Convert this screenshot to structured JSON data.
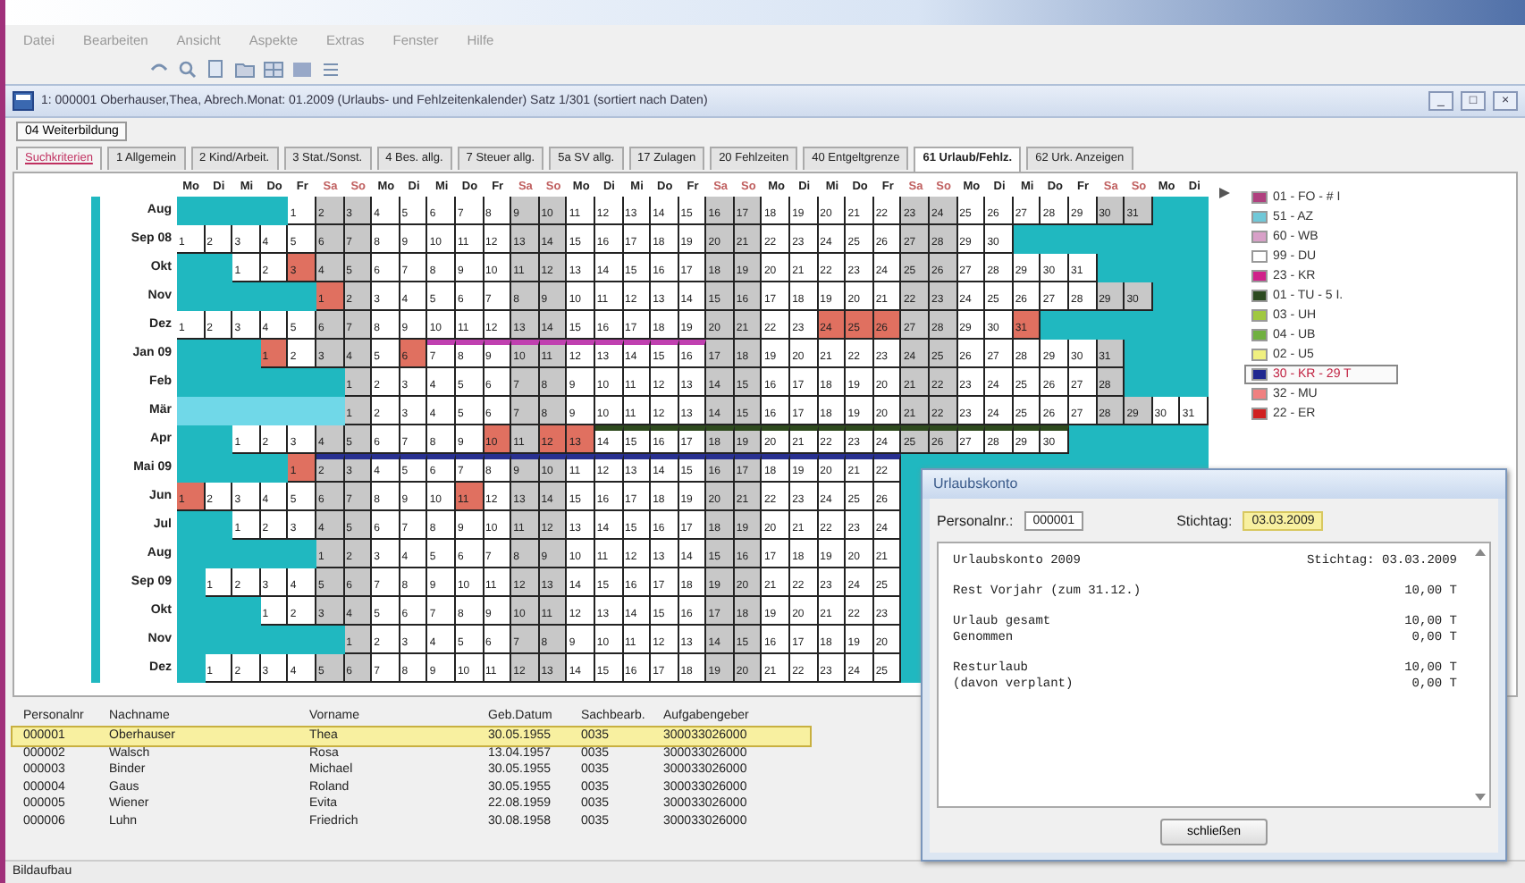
{
  "menu": [
    "Datei",
    "Bearbeiten",
    "Ansicht",
    "Aspekte",
    "Extras",
    "Fenster",
    "Hilfe"
  ],
  "form_title": "1: 000001 Oberhauser,Thea, Abrech.Monat: 01.2009  (Urlaubs- und Fehlzeitenkalender)   Satz 1/301 (sortiert nach Daten)",
  "window_buttons": [
    "_",
    "□",
    "×"
  ],
  "top_button": "04 Weiterbildung",
  "tabs": [
    {
      "label": "Suchkriterien",
      "selected": false,
      "kind": "link"
    },
    {
      "label": "1 Allgemein",
      "selected": false,
      "kind": "tab"
    },
    {
      "label": "2 Kind/Arbeit.",
      "selected": false,
      "kind": "tab"
    },
    {
      "label": "3 Stat./Sonst.",
      "selected": false,
      "kind": "tab"
    },
    {
      "label": "4 Bes. allg.",
      "selected": false,
      "kind": "tab"
    },
    {
      "label": "7 Steuer allg.",
      "selected": false,
      "kind": "tab"
    },
    {
      "label": "5a SV allg.",
      "selected": false,
      "kind": "tab"
    },
    {
      "label": "17 Zulagen",
      "selected": false,
      "kind": "tab"
    },
    {
      "label": "20 Fehlzeiten",
      "selected": false,
      "kind": "tab"
    },
    {
      "label": "40 Entgeltgrenze",
      "selected": false,
      "kind": "tab"
    },
    {
      "label": "61 Urlaub/Fehlz.",
      "selected": true,
      "kind": "tab"
    },
    {
      "label": "62 Urk. Anzeigen",
      "selected": false,
      "kind": "tab"
    }
  ],
  "weekdays": [
    {
      "text": "Mo",
      "kind": "work"
    },
    {
      "text": "Di",
      "kind": "work"
    },
    {
      "text": "Mi",
      "kind": "work"
    },
    {
      "text": "Do",
      "kind": "work"
    },
    {
      "text": "Fr",
      "kind": "work"
    },
    {
      "text": "Sa",
      "kind": "weekend"
    },
    {
      "text": "So",
      "kind": "weekend"
    },
    {
      "text": "Mo",
      "kind": "work"
    },
    {
      "text": "Di",
      "kind": "work"
    },
    {
      "text": "Mi",
      "kind": "work"
    },
    {
      "text": "Do",
      "kind": "work"
    },
    {
      "text": "Fr",
      "kind": "work"
    },
    {
      "text": "Sa",
      "kind": "weekend"
    },
    {
      "text": "So",
      "kind": "weekend"
    },
    {
      "text": "Mo",
      "kind": "work"
    },
    {
      "text": "Di",
      "kind": "work"
    },
    {
      "text": "Mi",
      "kind": "work"
    },
    {
      "text": "Do",
      "kind": "work"
    },
    {
      "text": "Fr",
      "kind": "work"
    },
    {
      "text": "Sa",
      "kind": "weekend"
    },
    {
      "text": "So",
      "kind": "weekend"
    },
    {
      "text": "Mo",
      "kind": "work"
    },
    {
      "text": "Di",
      "kind": "work"
    },
    {
      "text": "Mi",
      "kind": "work"
    },
    {
      "text": "Do",
      "kind": "work"
    },
    {
      "text": "Fr",
      "kind": "work"
    },
    {
      "text": "Sa",
      "kind": "weekend"
    },
    {
      "text": "So",
      "kind": "weekend"
    },
    {
      "text": "Mo",
      "kind": "work"
    },
    {
      "text": "Di",
      "kind": "work"
    },
    {
      "text": "Mi",
      "kind": "work"
    },
    {
      "text": "Do",
      "kind": "work"
    },
    {
      "text": "Fr",
      "kind": "work"
    },
    {
      "text": "Sa",
      "kind": "weekend"
    },
    {
      "text": "So",
      "kind": "weekend"
    },
    {
      "text": "Mo",
      "kind": "work"
    },
    {
      "text": "Di",
      "kind": "work"
    }
  ],
  "months": [
    {
      "label": "Aug",
      "selected": false,
      "days": [
        {
          "kind": "blocked"
        },
        {
          "kind": "blocked"
        },
        {
          "kind": "blocked"
        },
        {
          "kind": "blocked"
        },
        "1",
        "2",
        "3",
        "4",
        "5",
        "6",
        "7",
        "8",
        "9",
        "10",
        "11",
        "12",
        "13",
        "14",
        "15",
        "16",
        "17",
        "18",
        "19",
        "20",
        "21",
        "22",
        "23",
        "24",
        "25",
        "26",
        "27",
        "28",
        "29",
        "30",
        "31"
      ]
    },
    {
      "label": "Sep 08",
      "selected": false,
      "days": [
        "1",
        "2",
        "3",
        "4",
        "5",
        "6",
        "7",
        "8",
        "9",
        "10",
        "11",
        "12",
        "13",
        "14",
        "15",
        "16",
        "17",
        "18",
        "19",
        "20",
        "21",
        "22",
        "23",
        "24",
        "25",
        "26",
        "27",
        "28",
        "29",
        "30"
      ]
    },
    {
      "label": "Okt",
      "selected": false,
      "days": [
        {
          "kind": "blocked"
        },
        {
          "kind": "blocked"
        },
        "1",
        "2",
        {
          "text": "3",
          "kind": "absence"
        },
        "4",
        "5",
        "6",
        "7",
        "8",
        "9",
        "10",
        "11",
        "12",
        "13",
        "14",
        "15",
        "16",
        "17",
        "18",
        "19",
        "20",
        "21",
        "22",
        "23",
        "24",
        "25",
        "26",
        "27",
        "28",
        "29",
        "30",
        "31"
      ]
    },
    {
      "label": "Nov",
      "selected": false,
      "days": [
        {
          "kind": "blocked"
        },
        {
          "kind": "blocked"
        },
        {
          "kind": "blocked"
        },
        {
          "kind": "blocked"
        },
        {
          "kind": "blocked"
        },
        {
          "text": "1",
          "kind": "absence"
        },
        "2",
        "3",
        "4",
        "5",
        "6",
        "7",
        "8",
        "9",
        "10",
        "11",
        "12",
        "13",
        "14",
        "15",
        "16",
        "17",
        "18",
        "19",
        "20",
        "21",
        "22",
        "23",
        "24",
        "25",
        "26",
        "27",
        "28",
        "29",
        "30"
      ]
    },
    {
      "label": "Dez",
      "selected": false,
      "days": [
        "1",
        "2",
        "3",
        "4",
        "5",
        "6",
        "7",
        "8",
        "9",
        "10",
        "11",
        "12",
        "13",
        "14",
        "15",
        "16",
        "17",
        "18",
        "19",
        "20",
        "21",
        "22",
        "23",
        {
          "text": "24",
          "kind": "absence"
        },
        {
          "text": "25",
          "kind": "absence"
        },
        {
          "text": "26",
          "kind": "absence"
        },
        "27",
        "28",
        "29",
        "30",
        {
          "text": "31",
          "kind": "absence"
        }
      ]
    },
    {
      "label": "Jan 09",
      "selected": false,
      "days": [
        {
          "kind": "blocked"
        },
        {
          "kind": "blocked"
        },
        {
          "kind": "blocked"
        },
        {
          "text": "1",
          "kind": "absence"
        },
        "2",
        "3",
        "4",
        "5",
        {
          "text": "6",
          "kind": "absence"
        },
        {
          "text": "7",
          "kind": "band",
          "color": "#c040b0"
        },
        {
          "text": "8",
          "kind": "band",
          "color": "#c040b0"
        },
        {
          "text": "9",
          "kind": "band",
          "color": "#c040b0"
        },
        {
          "text": "10",
          "kind": "band",
          "color": "#c040b0"
        },
        {
          "text": "11",
          "kind": "band",
          "color": "#c040b0"
        },
        {
          "text": "12",
          "kind": "band",
          "color": "#c040b0"
        },
        {
          "text": "13",
          "kind": "band",
          "color": "#c040b0"
        },
        {
          "text": "14",
          "kind": "band",
          "color": "#c040b0"
        },
        {
          "text": "15",
          "kind": "band",
          "color": "#c040b0"
        },
        {
          "text": "16",
          "kind": "band",
          "color": "#c040b0"
        },
        "17",
        "18",
        "19",
        "20",
        "21",
        "22",
        "23",
        "24",
        "25",
        "26",
        "27",
        "28",
        "29",
        "30",
        "31"
      ]
    },
    {
      "label": "Feb",
      "selected": false,
      "days": [
        {
          "kind": "blocked"
        },
        {
          "kind": "blocked"
        },
        {
          "kind": "blocked"
        },
        {
          "kind": "blocked"
        },
        {
          "kind": "blocked"
        },
        {
          "kind": "blocked"
        },
        "1",
        "2",
        "3",
        "4",
        "5",
        "6",
        "7",
        "8",
        "9",
        "10",
        "11",
        "12",
        "13",
        "14",
        "15",
        "16",
        "17",
        "18",
        "19",
        "20",
        "21",
        "22",
        "23",
        "24",
        "25",
        "26",
        "27",
        "28"
      ]
    },
    {
      "label": "Mär",
      "selected": true,
      "days": [
        {
          "kind": "blocked"
        },
        {
          "kind": "blocked"
        },
        {
          "kind": "blocked"
        },
        {
          "kind": "blocked"
        },
        {
          "kind": "blocked"
        },
        {
          "kind": "blocked"
        },
        "1",
        "2",
        "3",
        "4",
        "5",
        "6",
        "7",
        "8",
        "9",
        "10",
        "11",
        "12",
        "13",
        "14",
        "15",
        "16",
        "17",
        "18",
        "19",
        "20",
        "21",
        "22",
        "23",
        "24",
        "25",
        "26",
        "27",
        "28",
        "29",
        "30",
        "31"
      ]
    },
    {
      "label": "Apr",
      "selected": false,
      "days": [
        {
          "kind": "blocked"
        },
        {
          "kind": "blocked"
        },
        "1",
        "2",
        "3",
        "4",
        "5",
        "6",
        "7",
        "8",
        "9",
        {
          "text": "10",
          "kind": "absence"
        },
        "11",
        {
          "text": "12",
          "kind": "absence"
        },
        {
          "text": "13",
          "kind": "absence"
        },
        {
          "text": "14",
          "kind": "band",
          "color": "#2e4a1e"
        },
        {
          "text": "15",
          "kind": "band",
          "color": "#2e4a1e"
        },
        {
          "text": "16",
          "kind": "band",
          "color": "#2e4a1e"
        },
        {
          "text": "17",
          "kind": "band",
          "color": "#2e4a1e"
        },
        {
          "text": "18",
          "kind": "band",
          "color": "#2e4a1e"
        },
        {
          "text": "19",
          "kind": "band",
          "color": "#2e4a1e"
        },
        {
          "text": "20",
          "kind": "band",
          "color": "#2e4a1e"
        },
        {
          "text": "21",
          "kind": "band",
          "color": "#2e4a1e"
        },
        {
          "text": "22",
          "kind": "band",
          "color": "#2e4a1e"
        },
        {
          "text": "23",
          "kind": "band",
          "color": "#2e4a1e"
        },
        {
          "text": "24",
          "kind": "band",
          "color": "#2e4a1e"
        },
        {
          "text": "25",
          "kind": "band",
          "color": "#2e4a1e"
        },
        {
          "text": "26",
          "kind": "band",
          "color": "#2e4a1e"
        },
        {
          "text": "27",
          "kind": "band",
          "color": "#2e4a1e"
        },
        {
          "text": "28",
          "kind": "band",
          "color": "#2e4a1e"
        },
        {
          "text": "29",
          "kind": "band",
          "color": "#2e4a1e"
        },
        {
          "text": "30",
          "kind": "band",
          "color": "#2e4a1e"
        }
      ]
    },
    {
      "label": "Mai 09",
      "selected": false,
      "days": [
        {
          "kind": "blocked"
        },
        {
          "kind": "blocked"
        },
        {
          "kind": "blocked"
        },
        {
          "kind": "blocked"
        },
        {
          "text": "1",
          "kind": "absence"
        },
        {
          "text": "2",
          "kind": "band",
          "color": "#283090"
        },
        {
          "text": "3",
          "kind": "band",
          "color": "#283090"
        },
        {
          "text": "4",
          "kind": "band",
          "color": "#283090"
        },
        {
          "text": "5",
          "kind": "band",
          "color": "#283090"
        },
        {
          "text": "6",
          "kind": "band",
          "color": "#283090"
        },
        {
          "text": "7",
          "kind": "band",
          "color": "#283090"
        },
        {
          "text": "8",
          "kind": "band",
          "color": "#283090"
        },
        {
          "text": "9",
          "kind": "band",
          "color": "#283090"
        },
        {
          "text": "10",
          "kind": "band",
          "color": "#283090"
        },
        {
          "text": "11",
          "kind": "band",
          "color": "#283090"
        },
        {
          "text": "12",
          "kind": "band",
          "color": "#283090"
        },
        {
          "text": "13",
          "kind": "band",
          "color": "#283090"
        },
        {
          "text": "14",
          "kind": "band",
          "color": "#283090"
        },
        {
          "text": "15",
          "kind": "band",
          "color": "#283090"
        },
        {
          "text": "16",
          "kind": "band",
          "color": "#283090"
        },
        {
          "text": "17",
          "kind": "band",
          "color": "#283090"
        },
        {
          "text": "18",
          "kind": "band",
          "color": "#283090"
        },
        {
          "text": "19",
          "kind": "band",
          "color": "#283090"
        },
        {
          "text": "20",
          "kind": "band",
          "color": "#283090"
        },
        {
          "text": "21",
          "kind": "band",
          "color": "#283090"
        },
        {
          "text": "22",
          "kind": "band",
          "color": "#283090"
        }
      ]
    },
    {
      "label": "Jun",
      "selected": false,
      "days": [
        {
          "text": "1",
          "kind": "absence"
        },
        "2",
        "3",
        "4",
        "5",
        "6",
        "7",
        "8",
        "9",
        "10",
        {
          "text": "11",
          "kind": "absence"
        },
        "12",
        "13",
        "14",
        "15",
        "16",
        "17",
        "18",
        "19",
        "20",
        "21",
        "22",
        "23",
        "24",
        "25",
        "26"
      ]
    },
    {
      "label": "Jul",
      "selected": false,
      "days": [
        {
          "kind": "blocked"
        },
        {
          "kind": "blocked"
        },
        "1",
        "2",
        "3",
        "4",
        "5",
        "6",
        "7",
        "8",
        "9",
        "10",
        "11",
        "12",
        "13",
        "14",
        "15",
        "16",
        "17",
        "18",
        "19",
        "20",
        "21",
        "22",
        "23",
        "24"
      ]
    },
    {
      "label": "Aug",
      "selected": false,
      "days": [
        {
          "kind": "blocked"
        },
        {
          "kind": "blocked"
        },
        {
          "kind": "blocked"
        },
        {
          "kind": "blocked"
        },
        {
          "kind": "blocked"
        },
        "1",
        "2",
        "3",
        "4",
        "5",
        "6",
        "7",
        "8",
        "9",
        "10",
        "11",
        "12",
        "13",
        "14",
        "15",
        "16",
        "17",
        "18",
        "19",
        "20",
        "21"
      ]
    },
    {
      "label": "Sep 09",
      "selected": false,
      "days": [
        {
          "kind": "blocked"
        },
        "1",
        "2",
        "3",
        "4",
        "5",
        "6",
        "7",
        "8",
        "9",
        "10",
        "11",
        "12",
        "13",
        "14",
        "15",
        "16",
        "17",
        "18",
        "19",
        "20",
        "21",
        "22",
        "23",
        "24",
        "25"
      ]
    },
    {
      "label": "Okt",
      "selected": false,
      "days": [
        {
          "kind": "blocked"
        },
        {
          "kind": "blocked"
        },
        {
          "kind": "blocked"
        },
        "1",
        "2",
        "3",
        "4",
        "5",
        "6",
        "7",
        "8",
        "9",
        "10",
        "11",
        "12",
        "13",
        "14",
        "15",
        "16",
        "17",
        "18",
        "19",
        "20",
        "21",
        "22",
        "23"
      ]
    },
    {
      "label": "Nov",
      "selected": false,
      "days": [
        {
          "kind": "blocked"
        },
        {
          "kind": "blocked"
        },
        {
          "kind": "blocked"
        },
        {
          "kind": "blocked"
        },
        {
          "kind": "blocked"
        },
        {
          "kind": "blocked"
        },
        "1",
        "2",
        "3",
        "4",
        "5",
        "6",
        "7",
        "8",
        "9",
        "10",
        "11",
        "12",
        "13",
        "14",
        "15",
        "16",
        "17",
        "18",
        "19",
        "20"
      ]
    },
    {
      "label": "Dez",
      "selected": false,
      "days": [
        {
          "kind": "blocked"
        },
        "1",
        "2",
        "3",
        "4",
        "5",
        "6",
        "7",
        "8",
        "9",
        "10",
        "11",
        "12",
        "13",
        "14",
        "15",
        "16",
        "17",
        "18",
        "19",
        "20",
        "21",
        "22",
        "23",
        "24",
        "25"
      ]
    }
  ],
  "legend": [
    {
      "label": "01 - FO - # I",
      "color": "#b0407f",
      "selected": false
    },
    {
      "label": "51 - AZ",
      "color": "#70c8d8",
      "selected": false
    },
    {
      "label": "60 - WB",
      "color": "#d8a0c8",
      "selected": false
    },
    {
      "label": "99 - DU",
      "color": "#ffffff",
      "selected": false
    },
    {
      "label": "23 - KR",
      "color": "#d0208a",
      "selected": false
    },
    {
      "label": "01 - TU - 5 I.",
      "color": "#2c4a20",
      "selected": false
    },
    {
      "label": "03 - UH",
      "color": "#a0c840",
      "selected": false
    },
    {
      "label": "04 - UB",
      "color": "#70b040",
      "selected": false
    },
    {
      "label": "02 - U5",
      "color": "#f0f080",
      "selected": false
    },
    {
      "label": "30 - KR - 29 T",
      "color": "#202890",
      "selected": true
    },
    {
      "label": "32 - MU",
      "color": "#f08080",
      "selected": false
    },
    {
      "label": "22 - ER",
      "color": "#d02020",
      "selected": false
    }
  ],
  "table": {
    "columns": [
      "Personalnr",
      "Nachname",
      "Vorname",
      "Geb.Datum",
      "Sachbearb.",
      "Aufgabengeber"
    ],
    "rows": [
      {
        "cells": [
          "000001",
          "Oberhauser",
          "Thea",
          "30.05.1955",
          "0035",
          "300033026000"
        ],
        "selected": true
      },
      {
        "cells": [
          "000002",
          "Walsch",
          "Rosa",
          "13.04.1957",
          "0035",
          "300033026000"
        ],
        "selected": false
      },
      {
        "cells": [
          "000003",
          "Binder",
          "Michael",
          "30.05.1955",
          "0035",
          "300033026000"
        ],
        "selected": false
      },
      {
        "cells": [
          "000004",
          "Gaus",
          "Roland",
          "30.05.1955",
          "0035",
          "300033026000"
        ],
        "selected": false
      },
      {
        "cells": [
          "000005",
          "Wiener",
          "Evita",
          "22.08.1959",
          "0035",
          "300033026000"
        ],
        "selected": false
      },
      {
        "cells": [
          "000006",
          "Luhn",
          "Friedrich",
          "30.08.1958",
          "0035",
          "300033026000"
        ],
        "selected": false
      }
    ]
  },
  "status_bar": "Bildaufbau",
  "dialog": {
    "title": "Urlaubskonto",
    "personalnr_label": "Personalnr.:",
    "personalnr": "000001",
    "stichtag_label": "Stichtag:",
    "stichtag": "03.03.2009",
    "sections": [
      [
        {
          "label": "Urlaubskonto 2009",
          "value": "Stichtag: 03.03.2009"
        }
      ],
      [
        {
          "label": "Rest Vorjahr (zum 31.12.)",
          "value": "10,00 T"
        }
      ],
      [
        {
          "label": "Urlaub gesamt",
          "value": "10,00 T"
        },
        {
          "label": "Genommen",
          "value": "0,00 T"
        }
      ],
      [
        {
          "label": "Resturlaub",
          "value": "10,00 T"
        },
        {
          "label": "(davon verplant)",
          "value": "0,00 T"
        }
      ]
    ],
    "close_button": "schließen"
  }
}
